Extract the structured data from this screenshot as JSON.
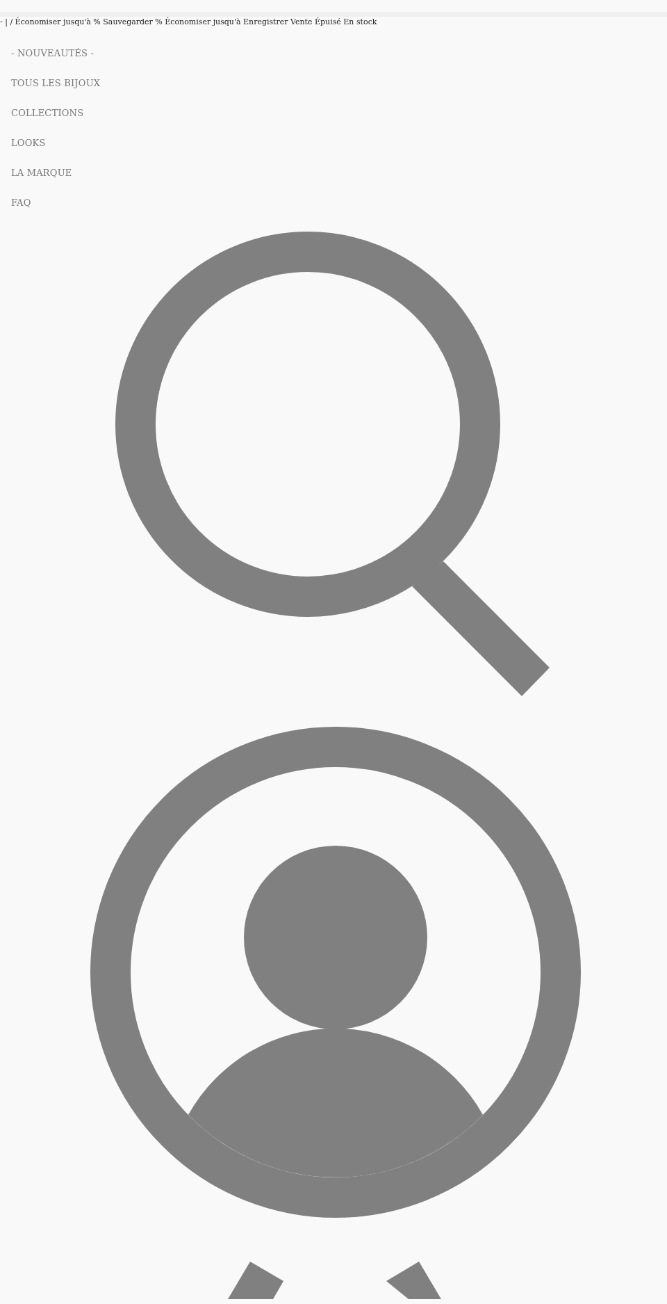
{
  "announcement": "- | / Économiser jusqu'à % Sauvegarder % Économiser jusqu'à Enregistrer Vente Épuisé En stock",
  "nav": {
    "items": [
      {
        "label": "- NOUVEAUTÉS -"
      },
      {
        "label": "TOUS LES BIJOUX"
      },
      {
        "label": "COLLECTIONS"
      },
      {
        "label": "LOOKS"
      },
      {
        "label": "LA MARQUE"
      },
      {
        "label": "FAQ"
      }
    ]
  }
}
